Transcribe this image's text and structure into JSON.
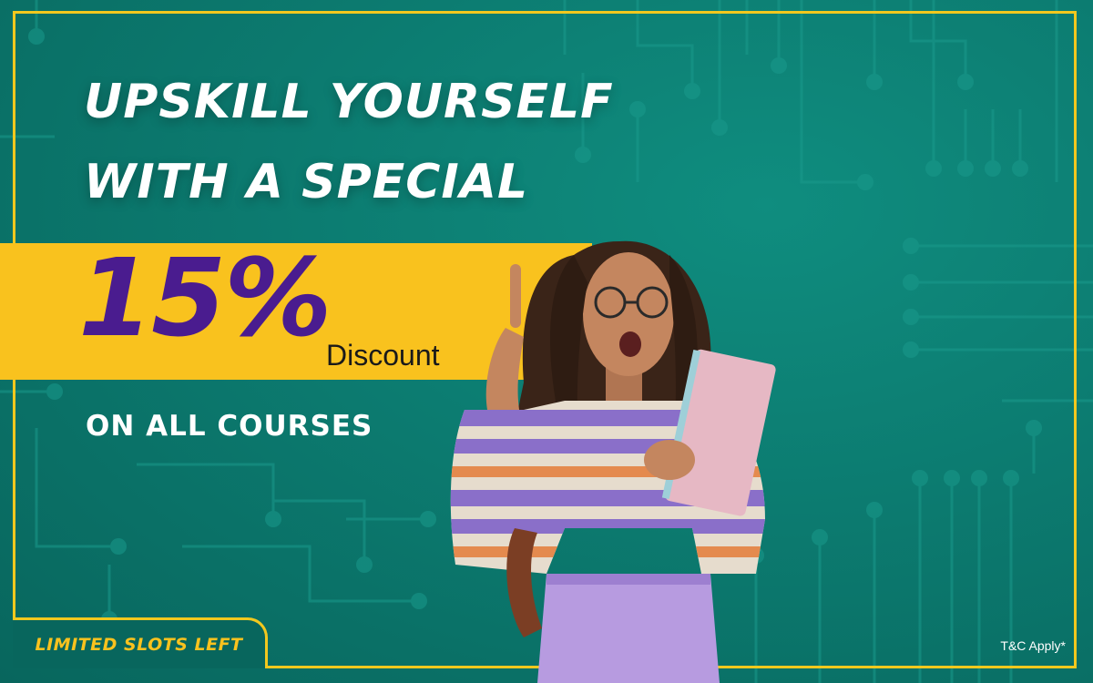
{
  "banner": {
    "headline_line1": "UPSKILL YOURSELF",
    "headline_line2": "WITH A SPECIAL",
    "discount_value": "15%",
    "discount_label": "Discount",
    "subline": "ON ALL COURSES",
    "slots_label": "LIMITED SLOTS LEFT",
    "terms": "T&C Apply*"
  },
  "colors": {
    "background": "#0c7b70",
    "accent_yellow": "#f9c21e",
    "frame": "#f2c81e",
    "discount_purple": "#4a1c8f",
    "text_white": "#ffffff"
  },
  "icons": {
    "background_pattern": "circuit-board-pattern",
    "hero_image": "student-holding-notebook-illustration"
  }
}
